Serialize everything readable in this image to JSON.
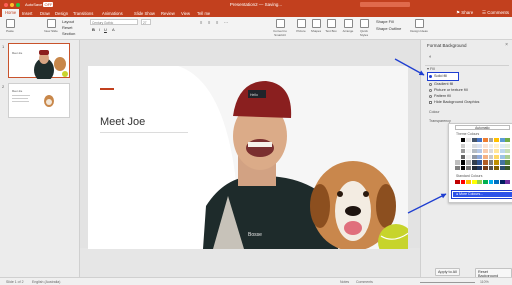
{
  "window": {
    "title": "Presentation2 — Saving...",
    "autosave_label": "AutoSave",
    "autosave_state": "OFF"
  },
  "tabs": [
    "Home",
    "Insert",
    "Draw",
    "Design",
    "Transitions",
    "Animations",
    "Slide Show",
    "Review",
    "View",
    "Tell me"
  ],
  "active_tab": "Home",
  "header_buttons": {
    "share": "Share",
    "comments": "Comments"
  },
  "ribbon": {
    "paste": "Paste",
    "new_slide": "New Slide",
    "layout": "Layout",
    "reset": "Reset",
    "section": "Section",
    "font_name": "Century Gothic",
    "font_size": "27",
    "picture": "Picture",
    "shapes": "Shapes",
    "text_box": "Text Box",
    "arrange": "Arrange",
    "quick_styles": "Quick Styles",
    "convert_smartart": "Convert to SmartArt",
    "shape_fill": "Shape Fill",
    "shape_outline": "Shape Outline",
    "design_ideas": "Design Ideas"
  },
  "slides_panel": {
    "numbers": [
      "1",
      "2"
    ],
    "thumb1_title": "Meet Joe",
    "thumb2_title": "Meet Joe"
  },
  "slide": {
    "title": "Meet Joe",
    "hat_text": "Hello",
    "shirt_text": "Bosse"
  },
  "format_pane": {
    "title": "Format Background",
    "section": "Fill",
    "options": [
      "Solid fill",
      "Gradient fill",
      "Picture or texture fill",
      "Pattern fill",
      "Hide Background Graphics"
    ],
    "selected_option": "Solid fill",
    "colour_label": "Colour",
    "transparency_label": "Transparency",
    "automatic": "Automatic",
    "theme_colours": "Theme Colours",
    "standard_colours": "Standard Colours",
    "more_colours": "More Colours...",
    "apply_all": "Apply to All",
    "reset_background": "Reset Background"
  },
  "status": {
    "slide": "Slide 1 of 2",
    "language": "English (Australia)",
    "notes": "Notes",
    "comments": "Comments",
    "zoom": "110%"
  },
  "colors": {
    "accent": "#c2401e",
    "highlight": "#1f3fd1"
  }
}
